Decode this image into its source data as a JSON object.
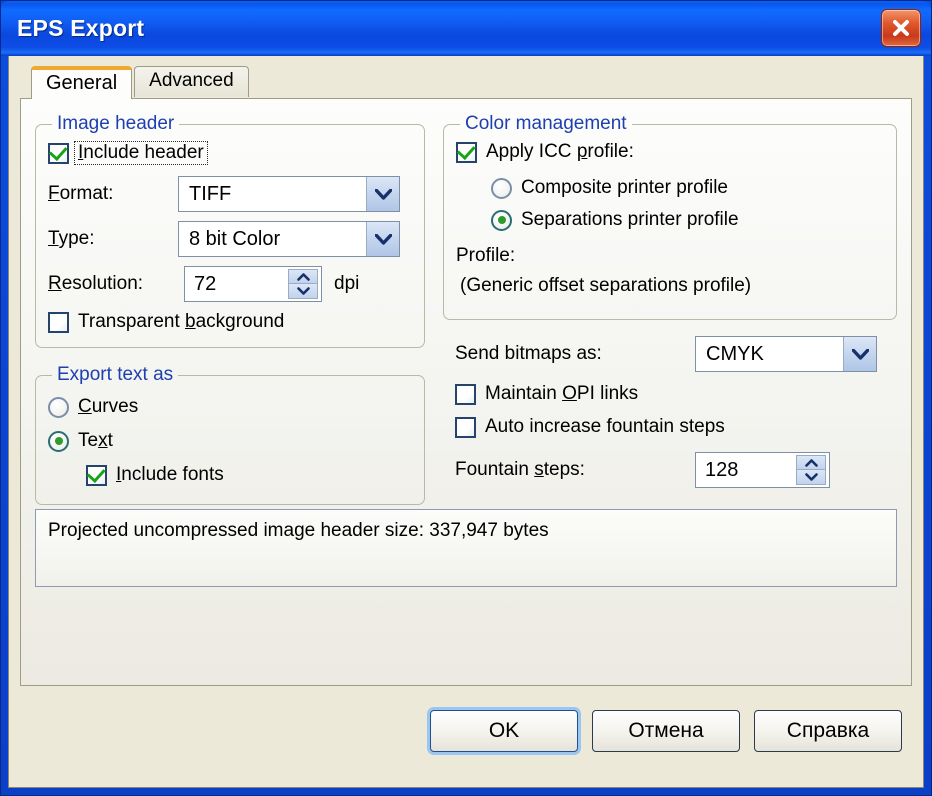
{
  "window": {
    "title": "EPS Export",
    "close_icon": "close-icon",
    "accent_titlebar": "#0b4fe0",
    "accent_close": "#c9391a",
    "accent_legend": "#1d3fb0",
    "accent_tab_active": "#f0a830",
    "accent_check": "#17a417",
    "accent_radio": "#2d9b2d"
  },
  "tabs": [
    {
      "label": "General",
      "active": true
    },
    {
      "label": "Advanced",
      "active": false
    }
  ],
  "image_header": {
    "legend": "Image header",
    "include_header": {
      "label": "Include header",
      "checked": true,
      "focused": true
    },
    "format": {
      "label": "Format:",
      "value": "TIFF"
    },
    "type": {
      "label": "Type:",
      "value": "8 bit Color"
    },
    "resolution": {
      "label": "Resolution:",
      "value": "72",
      "unit": "dpi"
    },
    "transparent_background": {
      "label": "Transparent background",
      "checked": false
    }
  },
  "export_text_as": {
    "legend": "Export text as",
    "curves": {
      "label": "Curves",
      "selected": false
    },
    "text": {
      "label": "Text",
      "selected": true
    },
    "include_fonts": {
      "label": "Include fonts",
      "checked": true
    }
  },
  "color_management": {
    "legend": "Color management",
    "apply_icc": {
      "label": "Apply ICC profile:",
      "checked": true
    },
    "composite": {
      "label": "Composite printer profile",
      "selected": false
    },
    "separations": {
      "label": "Separations printer profile",
      "selected": true
    },
    "profile_label": "Profile:",
    "profile_value": "(Generic offset separations profile)"
  },
  "bitmap_options": {
    "send_bitmaps_as": {
      "label": "Send bitmaps as:",
      "value": "CMYK"
    },
    "maintain_opi": {
      "label": "Maintain OPI links",
      "checked": false
    },
    "auto_increase": {
      "label": "Auto increase fountain steps",
      "checked": false
    },
    "fountain_steps": {
      "label": "Fountain steps:",
      "value": "128"
    }
  },
  "status": {
    "text": "Projected uncompressed image header size: 337,947 bytes"
  },
  "buttons": {
    "ok": "OK",
    "cancel": "Отмена",
    "help": "Справка"
  }
}
